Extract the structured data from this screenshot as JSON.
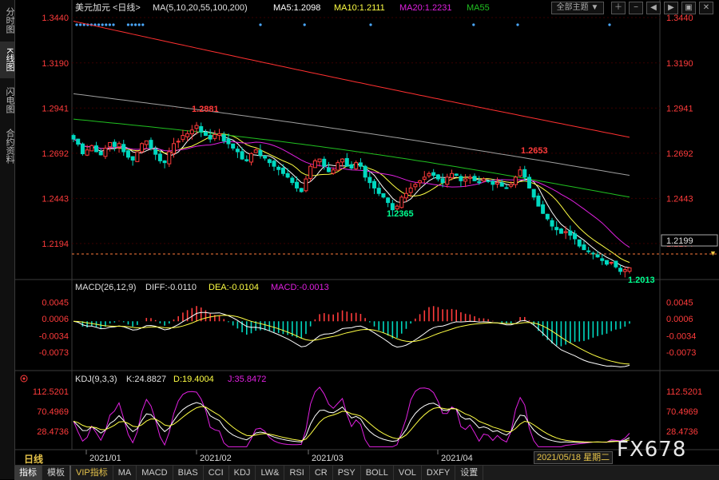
{
  "sidebar": {
    "tabs": [
      {
        "label": "分时图",
        "active": false
      },
      {
        "label": "K线图",
        "active": true
      },
      {
        "label": "闪电图",
        "active": false
      },
      {
        "label": "合约资料",
        "active": false
      }
    ]
  },
  "header": {
    "symbol": "美元加元",
    "period": "<日线>",
    "ma_label": "MA(5,10,20,55,100,200)",
    "ma5": "MA5:1.2098",
    "ma10": "MA10:1.2111",
    "ma20": "MA20:1.2231",
    "ma55": "MA55",
    "theme_button": "全部主题",
    "theme_arrow": "▼"
  },
  "colors": {
    "up": "#ff3b3b",
    "down": "#00d8c0",
    "ma5": "#ffffff",
    "ma10": "#ffff44",
    "ma20": "#e020e0",
    "ma55": "#20c020",
    "ma100": "#a0a0a0",
    "ma200": "#ff3030",
    "axis_text": "#ff3b3b",
    "high_label": "#ff3b3b",
    "low_label": "#00ff90",
    "period": "#e6c34a"
  },
  "chart_data": [
    {
      "type": "candlestick",
      "title": "美元加元",
      "ylim": [
        1.2013,
        1.344
      ],
      "yticks": [
        "1.3440",
        "1.3190",
        "1.2941",
        "1.2692",
        "1.2443",
        "1.2194"
      ],
      "xticks": [
        "2021/01",
        "2021/02",
        "2021/03",
        "2021/04"
      ],
      "current_price": "1.2199",
      "annotations": [
        {
          "label": "1.2881",
          "value": 1.2881,
          "kind": "high"
        },
        {
          "label": "1.2365",
          "value": 1.2365,
          "kind": "low"
        },
        {
          "label": "1.2653",
          "value": 1.2653,
          "kind": "high"
        },
        {
          "label": "1.2013",
          "value": 1.2013,
          "kind": "low"
        }
      ],
      "closes": [
        1.277,
        1.2742,
        1.2689,
        1.271,
        1.2734,
        1.27,
        1.2683,
        1.272,
        1.2751,
        1.2729,
        1.2745,
        1.27,
        1.267,
        1.2654,
        1.27,
        1.2745,
        1.276,
        1.272,
        1.2686,
        1.265,
        1.264,
        1.27,
        1.2745,
        1.2758,
        1.279,
        1.28,
        1.282,
        1.2845,
        1.281,
        1.279,
        1.277,
        1.2795,
        1.28,
        1.276,
        1.2744,
        1.272,
        1.27,
        1.266,
        1.265,
        1.269,
        1.271,
        1.268,
        1.2665,
        1.264,
        1.262,
        1.2602,
        1.258,
        1.256,
        1.253,
        1.25,
        1.248,
        1.255,
        1.262,
        1.265,
        1.266,
        1.262,
        1.259,
        1.26,
        1.264,
        1.266,
        1.262,
        1.261,
        1.264,
        1.262,
        1.256,
        1.253,
        1.25,
        1.247,
        1.245,
        1.242,
        1.238,
        1.24,
        1.245,
        1.247,
        1.25,
        1.252,
        1.254,
        1.256,
        1.258,
        1.257,
        1.255,
        1.253,
        1.256,
        1.258,
        1.257,
        1.254,
        1.255,
        1.256,
        1.254,
        1.253,
        1.255,
        1.254,
        1.252,
        1.253,
        1.251,
        1.25,
        1.252,
        1.256,
        1.26,
        1.256,
        1.25,
        1.245,
        1.24,
        1.236,
        1.233,
        1.229,
        1.227,
        1.225,
        1.226,
        1.224,
        1.222,
        1.218,
        1.216,
        1.215,
        1.214,
        1.212,
        1.21,
        1.208,
        1.209,
        1.2065,
        1.204,
        1.205,
        1.206
      ],
      "ma_series": [
        {
          "name": "MA5",
          "color_key": "ma5"
        },
        {
          "name": "MA10",
          "color_key": "ma10"
        },
        {
          "name": "MA20",
          "color_key": "ma20"
        },
        {
          "name": "MA55",
          "color_key": "ma55"
        },
        {
          "name": "MA100",
          "color_key": "ma100"
        },
        {
          "name": "MA200",
          "color_key": "ma200"
        }
      ]
    },
    {
      "type": "macd",
      "title": "MACD(26,12,9)",
      "diff": "DIFF:-0.0110",
      "dea": "DEA:-0.0104",
      "macd": "MACD:-0.0013",
      "ylim": [
        -0.0112,
        0.0068
      ],
      "yticks": [
        "0.0045",
        "0.0006",
        "-0.0034",
        "-0.0073"
      ]
    },
    {
      "type": "kdj",
      "title": "KDJ(9,3,3)",
      "k": "K:24.8827",
      "d": "D:19.4004",
      "j": "J:35.8472",
      "ylim": [
        -5,
        126
      ],
      "yticks": [
        "112.5201",
        "70.4969",
        "28.4736"
      ]
    }
  ],
  "footer": {
    "period_label": "日线",
    "date_badge": "2021/05/18 星期二",
    "watermark": "FX678",
    "tabs": [
      {
        "label": "指标",
        "active": true
      },
      {
        "label": "模板",
        "active": false
      },
      {
        "label": "VIP指标",
        "vip": true
      },
      {
        "label": "MA"
      },
      {
        "label": "MACD"
      },
      {
        "label": "BIAS"
      },
      {
        "label": "CCI"
      },
      {
        "label": "KDJ"
      },
      {
        "label": "LW&"
      },
      {
        "label": "RSI"
      },
      {
        "label": "CR"
      },
      {
        "label": "PSY"
      },
      {
        "label": "BOLL"
      },
      {
        "label": "VOL"
      },
      {
        "label": "DXFY"
      },
      {
        "label": "设置"
      }
    ]
  }
}
